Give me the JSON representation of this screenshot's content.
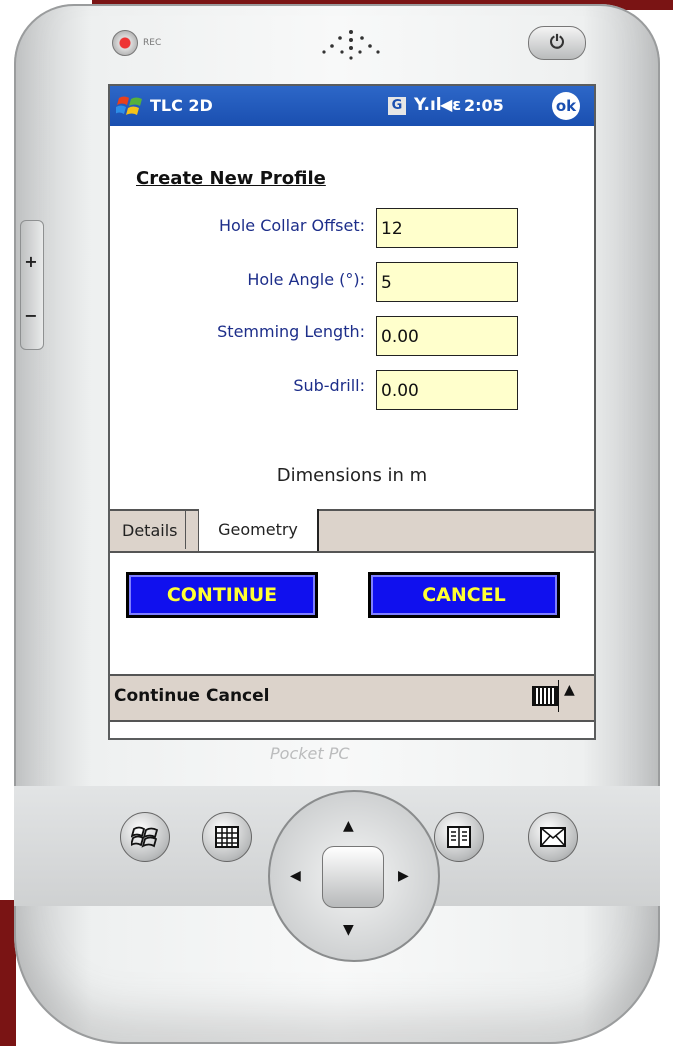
{
  "device": {
    "rec_label": "REC",
    "power_glyph": "⏻",
    "side_plus": "+",
    "side_minus": "−",
    "brand": "Pocket PC"
  },
  "titlebar": {
    "app_title": "TLC 2D",
    "network_badge": "G",
    "signal_glyph": "Y.ıl",
    "volume_glyph": "◀ε",
    "clock": "2:05",
    "ok_label": "ok",
    "start_icon": "windows-flag-icon"
  },
  "form": {
    "heading": "Create New Profile",
    "fields": [
      {
        "label": "Hole Collar Offset:",
        "value": "12"
      },
      {
        "label": "Hole Angle (°):",
        "value": "5"
      },
      {
        "label": "Stemming Length:",
        "value": "0.00"
      },
      {
        "label": "Sub-drill:",
        "value": "0.00"
      }
    ],
    "units_note": "Dimensions in m"
  },
  "tabs": [
    {
      "label": "Details",
      "active": false
    },
    {
      "label": "Geometry",
      "active": true
    }
  ],
  "buttons": {
    "continue": "CONTINUE",
    "cancel": "CANCEL"
  },
  "menubar": {
    "continue": "Continue",
    "cancel": "Cancel",
    "sip_arrow": "▲"
  },
  "hardware_buttons": {
    "button1_icon": "windows-start-icon",
    "button2_icon": "calendar-icon",
    "button3_icon": "contacts-icon",
    "button4_icon": "messaging-icon",
    "arrows": {
      "up": "▲",
      "down": "▼",
      "left": "◀",
      "right": "▶"
    }
  },
  "colors": {
    "titlebar": "#1a4fb0",
    "input_bg": "#ffffcc",
    "button_bg": "#1010ee",
    "button_text": "#ffff33",
    "label_text": "#1d2e8a",
    "menubar_bg": "#dcd3cb",
    "accent_dark_red": "#7a1414"
  }
}
